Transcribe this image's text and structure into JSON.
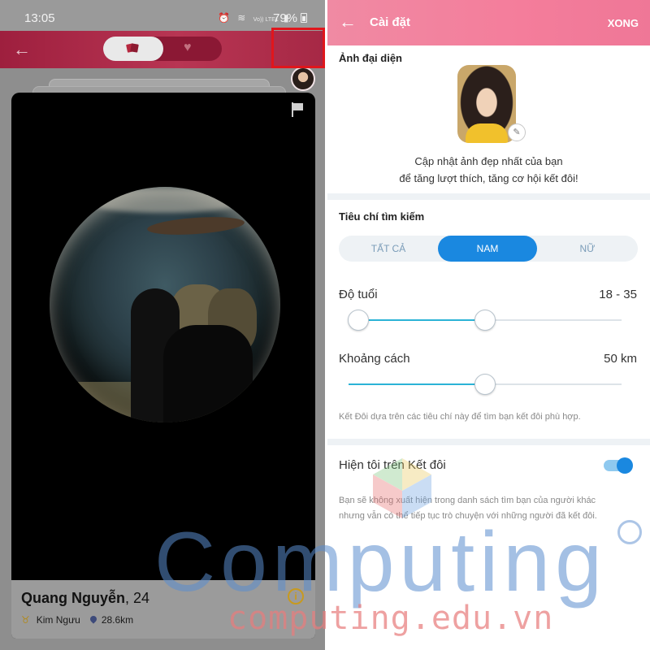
{
  "left_panel": {
    "status_bar": {
      "time": "13:05",
      "battery": "79%",
      "signal_text": "Vo)) LTE1"
    },
    "card": {
      "name": "Quang Nguyễn",
      "age": ", 24",
      "zodiac": "Kim Ngưu",
      "distance": "28.6km",
      "info_icon": "i"
    }
  },
  "right_panel": {
    "header": {
      "title": "Cài đặt",
      "done": "XONG"
    },
    "avatar_section": {
      "title": "Ảnh đại diện",
      "desc_line1": "Cập nhật ảnh đẹp nhất của bạn",
      "desc_line2": "để tăng lượt thích, tăng cơ hội kết đôi!"
    },
    "search_section": {
      "title": "Tiêu chí tìm kiếm",
      "gender_options": [
        "TẤT CẢ",
        "NAM",
        "NỮ"
      ],
      "selected_gender": "NAM",
      "age_label": "Độ tuổi",
      "age_value": "18 - 35",
      "age_min_fraction": 0.0,
      "age_max_fraction": 0.5,
      "distance_label": "Khoảng cách",
      "distance_value": "50 km",
      "distance_fraction": 0.5,
      "note": "Kết Đôi dựa trên các tiêu chí này để tìm bạn kết đôi phù hợp."
    },
    "visibility_section": {
      "label": "Hiện tôi trên Kết đôi",
      "toggle_on": true,
      "note_line1": "Bạn sẽ không xuất hiện trong danh sách tìm bạn của người khác",
      "note_line2": "nhưng vẫn có thể tiếp tục trò chuyện với những người đã kết đôi."
    }
  },
  "watermark": {
    "big": "Computing",
    "small": "computing.edu.vn"
  },
  "colors": {
    "accent_blue": "#1a88e0",
    "slider_fill": "#2bb3d6",
    "header_pink": "#f47d9b",
    "left_header": "#b83553",
    "highlight_red": "#e0161c"
  }
}
